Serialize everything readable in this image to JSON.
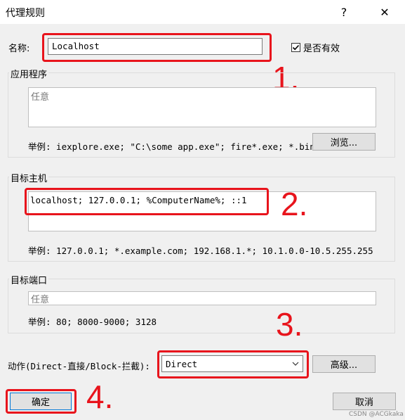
{
  "window": {
    "title": "代理规则",
    "help_label": "?",
    "close_label": "✕"
  },
  "name": {
    "label": "名称:",
    "value": "Localhost"
  },
  "enabled": {
    "label": "是否有效",
    "checked": true
  },
  "applications": {
    "group_label": "应用程序",
    "value": "任意",
    "example": "举例: iexplore.exe; \"C:\\some app.exe\"; fire*.exe; *.bin",
    "browse_label": "浏览..."
  },
  "target_hosts": {
    "group_label": "目标主机",
    "value": "localhost; 127.0.0.1; %ComputerName%; ::1",
    "example": "举例: 127.0.0.1; *.example.com; 192.168.1.*; 10.1.0.0-10.5.255.255"
  },
  "target_ports": {
    "group_label": "目标端口",
    "value": "任意",
    "example": "举例: 80; 8000-9000; 3128"
  },
  "action": {
    "label": "动作(Direct-直接/Block-拦截):",
    "selected": "Direct",
    "advanced_label": "高级..."
  },
  "footer": {
    "ok_label": "确定",
    "cancel_label": "取消"
  },
  "annotations": {
    "n1": "1.",
    "n2": "2.",
    "n3": "3.",
    "n4": "4."
  },
  "watermark": "CSDN @ACGkaka",
  "colors": {
    "highlight": "#e8141c",
    "background": "#f0f0f0"
  },
  "icons": {
    "dropdown": "chevron-down-icon",
    "checkbox": "checkmark-icon"
  }
}
